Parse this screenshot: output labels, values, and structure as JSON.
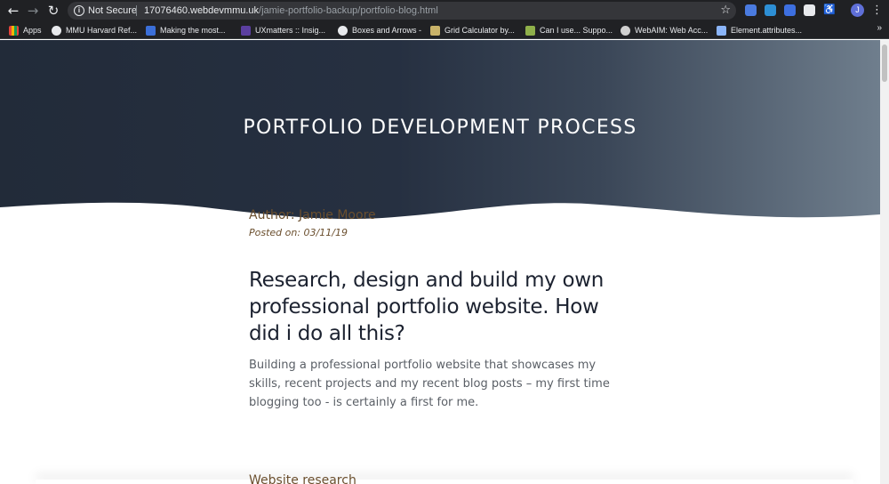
{
  "browser": {
    "security_label": "Not Secure",
    "url_host": "17076460.webdevmmu.uk",
    "url_path": "/jamie-portfolio-backup/portfolio-blog.html",
    "profile_initial": "J",
    "icons": {
      "back": "back-arrow-icon",
      "forward": "forward-arrow-icon",
      "reload": "reload-icon",
      "info": "info-icon",
      "star": "star-icon",
      "menu": "kebab-menu-icon"
    }
  },
  "bookmarks": [
    {
      "label": "Apps",
      "color": "#e8453c"
    },
    {
      "label": "MMU Harvard Ref...",
      "color": "#e8eaed"
    },
    {
      "label": "Making the most...",
      "color": "#3b6fd8"
    },
    {
      "label": "UXmatters :: Insig...",
      "color": "#5b3fa0"
    },
    {
      "label": "Boxes and Arrows -",
      "color": "#e8eaed"
    },
    {
      "label": "Grid Calculator by...",
      "color": "#c9b36a"
    },
    {
      "label": "Can I use... Suppo...",
      "color": "#8fb04a"
    },
    {
      "label": "WebAIM: Web Acc...",
      "color": "#d0d0d0"
    },
    {
      "label": "Element.attributes...",
      "color": "#8ab4f8"
    }
  ],
  "page": {
    "hero_title": "PORTFOLIO DEVELOPMENT PROCESS",
    "author": "Author: Jamie Moore",
    "posted": "Posted on: 03/11/19",
    "headline": "Research, design and build my own professional portfolio website. How did i do all this?",
    "intro": "Building a professional portfolio website that showcases my skills, recent projects and my recent blog posts – my first time blogging too - is certainly a first for me.",
    "section_heading": "Website research"
  },
  "colors": {
    "hero_dark": "#222b39",
    "hero_light": "#6f7e8d",
    "accent_brown": "#6b4f2e",
    "headline_text": "#1c2230"
  }
}
